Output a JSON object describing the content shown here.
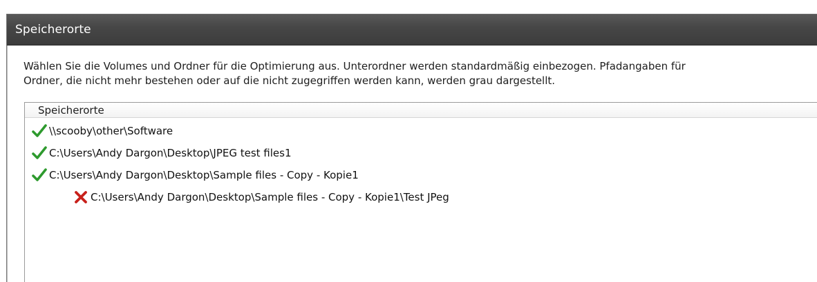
{
  "window": {
    "title": "Speicherorte"
  },
  "description": {
    "line1": "Wählen Sie die Volumes und Ordner für die Optimierung aus. Unterordner werden standardmäßig einbezogen. Pfadangaben für",
    "line2": "Ordner, die nicht mehr bestehen oder auf die nicht zugegriffen werden kann, werden grau dargestellt."
  },
  "list": {
    "column_header": "Speicherorte",
    "items": [
      {
        "path": "\\\\scooby\\other\\Software",
        "status": "check-icon",
        "level": 0
      },
      {
        "path": "C:\\Users\\Andy Dargon\\Desktop\\JPEG test files1",
        "status": "check-icon",
        "level": 0
      },
      {
        "path": "C:\\Users\\Andy Dargon\\Desktop\\Sample files - Copy - Kopie1",
        "status": "check-icon",
        "level": 0
      },
      {
        "path": "C:\\Users\\Andy Dargon\\Desktop\\Sample files - Copy - Kopie1\\Test JPeg",
        "status": "cross-icon",
        "level": 1
      }
    ]
  },
  "colors": {
    "check": "#2e9a2e",
    "cross": "#c8211b",
    "titlebar": "#454545"
  }
}
